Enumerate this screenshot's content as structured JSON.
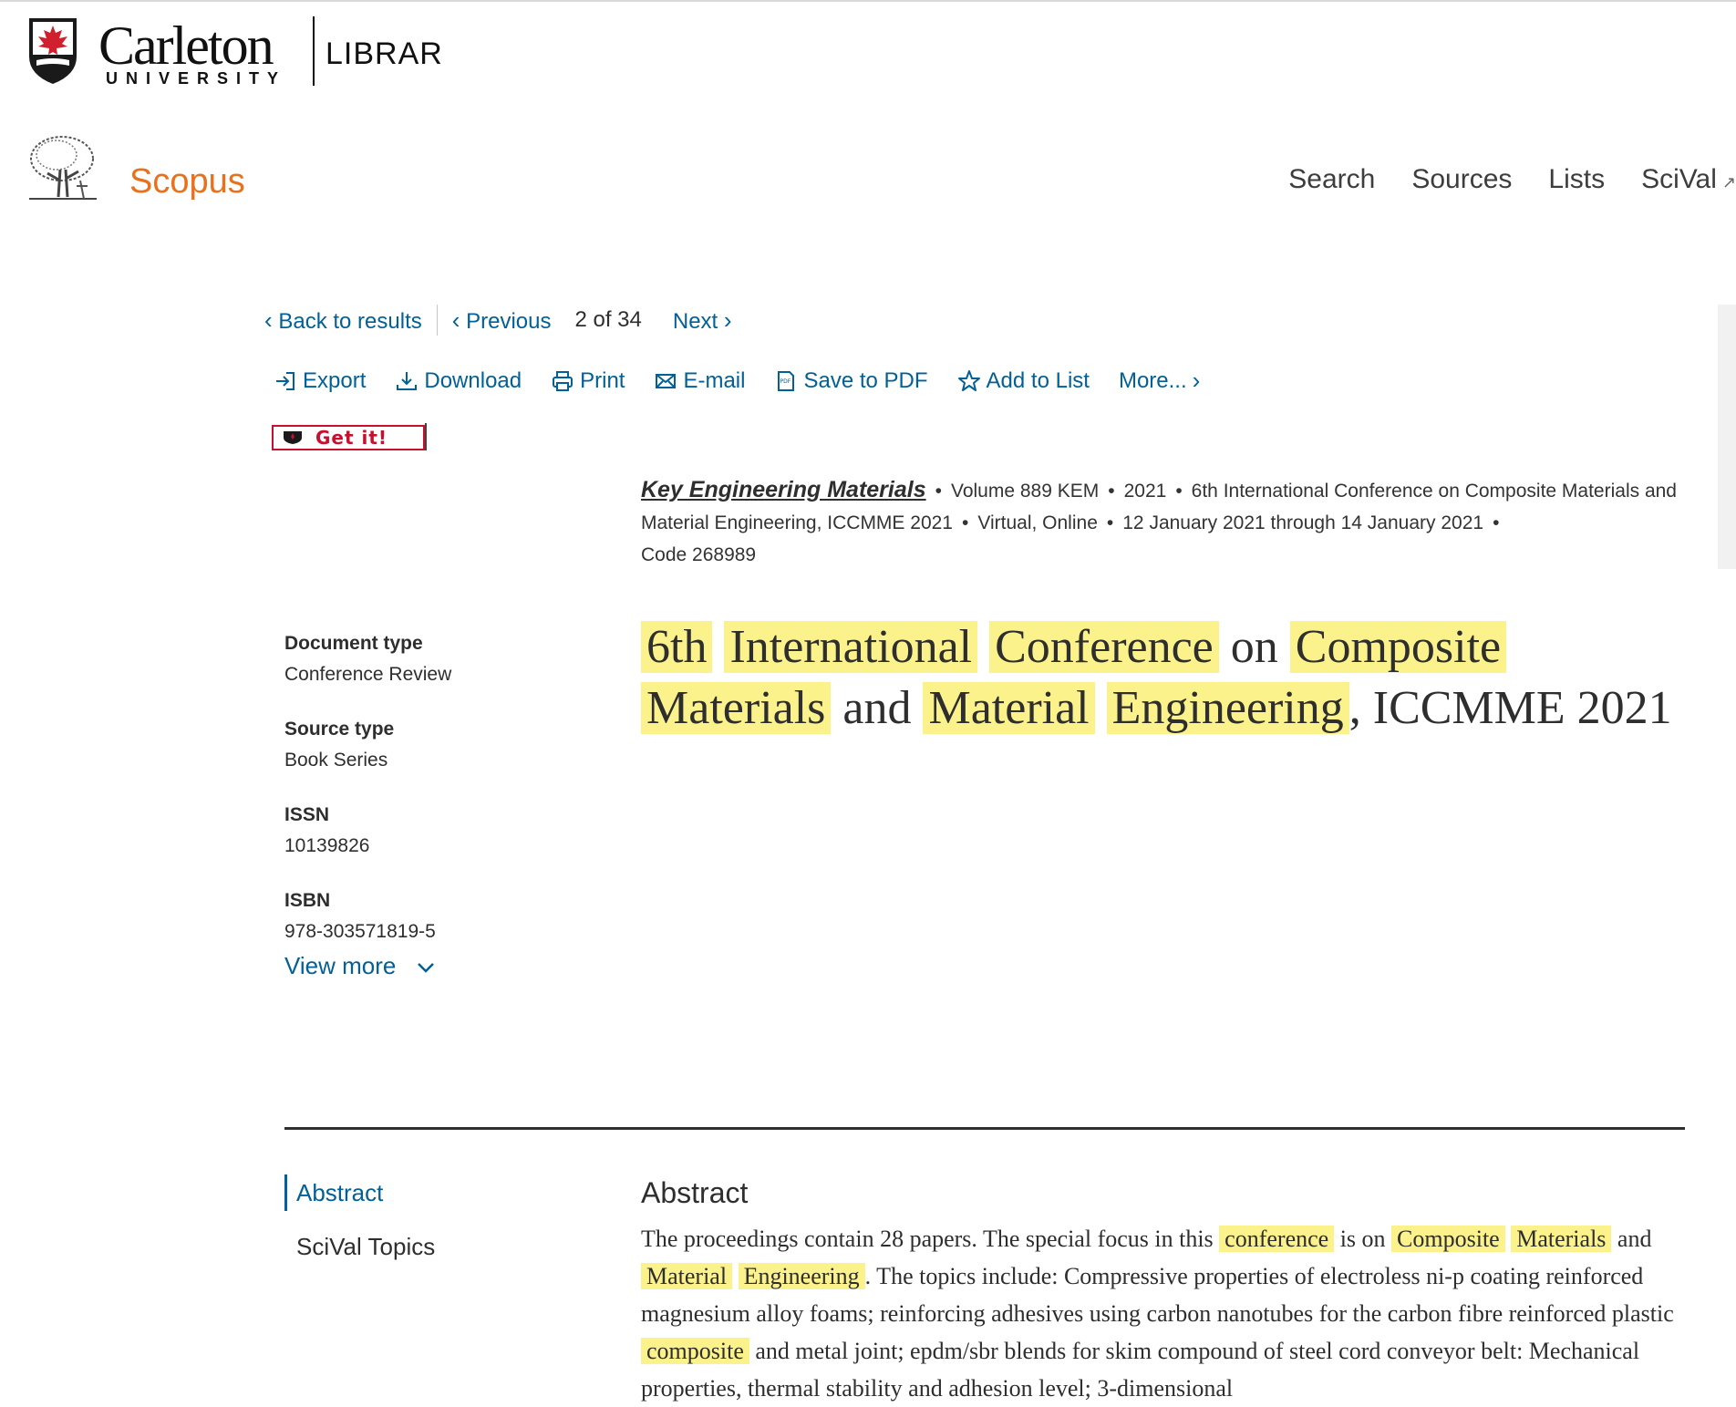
{
  "carleton": {
    "name": "Carleton",
    "sub": "UNIVERSITY",
    "library": "LIBRARY"
  },
  "scopus": {
    "brand": "Scopus"
  },
  "topnav": {
    "search": "Search",
    "sources": "Sources",
    "lists": "Lists",
    "scival": "SciVal",
    "scival_ext": "↗"
  },
  "navigation": {
    "back": "Back to results",
    "previous": "Previous",
    "position": "2 of 34",
    "next": "Next"
  },
  "toolbar": {
    "export": "Export",
    "download": "Download",
    "print": "Print",
    "email": "E-mail",
    "save_pdf": "Save to PDF",
    "add_list": "Add to List",
    "more": "More..."
  },
  "getit": {
    "label": "Get it!"
  },
  "source_info": {
    "journal": "Key Engineering Materials",
    "volume": "Volume 889 KEM",
    "year": "2021",
    "conference": "6th International Conference on Composite Materials and Material Engineering, ICCMME 2021",
    "location": "Virtual, Online",
    "dates": "12 January 2021 through 14 January 2021",
    "code": "Code 268989"
  },
  "metadata": {
    "doc_type_label": "Document type",
    "doc_type_value": "Conference Review",
    "source_type_label": "Source type",
    "source_type_value": "Book Series",
    "issn_label": "ISSN",
    "issn_value": "10139826",
    "isbn_label": "ISBN",
    "isbn_value": "978-303571819-5",
    "view_more": "View more"
  },
  "title": {
    "w1": "6th",
    "w2": "International",
    "w3": "Conference",
    "w4": "on",
    "w5": "Composite",
    "w6": "Materials",
    "w7": "and",
    "w8": "Material",
    "w9": "Engineering",
    "w10": ", ICCMME 2021"
  },
  "sidenav": {
    "abstract": "Abstract",
    "scival_topics": "SciVal Topics"
  },
  "abstract": {
    "heading": "Abstract",
    "p1": "The proceedings contain 28 papers. The special focus in this ",
    "h1": "conference",
    "p2": " is on ",
    "h2": "Composite",
    "h3": "Materials",
    "p3": " and ",
    "h4": "Material",
    "h5": "Engineering",
    "p4": ". The topics include: Compressive properties of electroless ni-p coating reinforced magnesium alloy foams; reinforcing adhesives using carbon nanotubes for the carbon fibre reinforced plastic ",
    "h6": "composite",
    "p5": " and metal joint; epdm/sbr blends for skim compound of steel cord conveyor belt: Mechanical properties, thermal stability and adhesion level; 3-dimensional"
  },
  "colors": {
    "link": "#006097",
    "scopus_orange": "#e9711c",
    "highlight": "#fbf28c",
    "getit_red": "#c8102e"
  }
}
